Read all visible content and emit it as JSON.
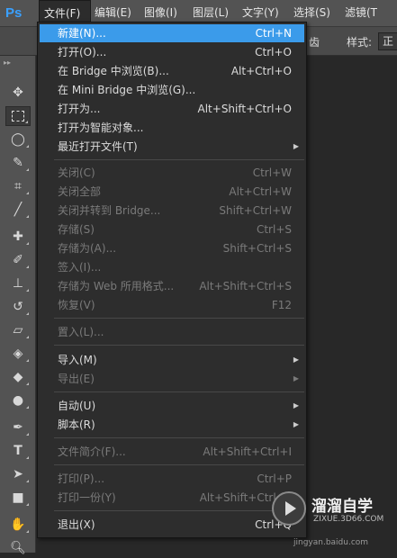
{
  "app": {
    "logo": "Ps"
  },
  "menubar": {
    "items": [
      {
        "label": "文件(F)"
      },
      {
        "label": "编辑(E)"
      },
      {
        "label": "图像(I)"
      },
      {
        "label": "图层(L)"
      },
      {
        "label": "文字(Y)"
      },
      {
        "label": "选择(S)"
      },
      {
        "label": "滤镜(T"
      }
    ]
  },
  "optionsbar": {
    "fragment": "齿",
    "style_label": "样式:",
    "style_value": "正"
  },
  "file_menu": {
    "items": [
      {
        "label": "新建(N)...",
        "shortcut": "Ctrl+N"
      },
      {
        "label": "打开(O)...",
        "shortcut": "Ctrl+O"
      },
      {
        "label": "在 Bridge 中浏览(B)...",
        "shortcut": "Alt+Ctrl+O"
      },
      {
        "label": "在 Mini Bridge 中浏览(G)...",
        "shortcut": ""
      },
      {
        "label": "打开为...",
        "shortcut": "Alt+Shift+Ctrl+O"
      },
      {
        "label": "打开为智能对象...",
        "shortcut": ""
      },
      {
        "label": "最近打开文件(T)",
        "shortcut": ""
      },
      {
        "label": "关闭(C)",
        "shortcut": "Ctrl+W"
      },
      {
        "label": "关闭全部",
        "shortcut": "Alt+Ctrl+W"
      },
      {
        "label": "关闭并转到 Bridge...",
        "shortcut": "Shift+Ctrl+W"
      },
      {
        "label": "存储(S)",
        "shortcut": "Ctrl+S"
      },
      {
        "label": "存储为(A)...",
        "shortcut": "Shift+Ctrl+S"
      },
      {
        "label": "签入(I)...",
        "shortcut": ""
      },
      {
        "label": "存储为 Web 所用格式...",
        "shortcut": "Alt+Shift+Ctrl+S"
      },
      {
        "label": "恢复(V)",
        "shortcut": "F12"
      },
      {
        "label": "置入(L)...",
        "shortcut": ""
      },
      {
        "label": "导入(M)",
        "shortcut": ""
      },
      {
        "label": "导出(E)",
        "shortcut": ""
      },
      {
        "label": "自动(U)",
        "shortcut": ""
      },
      {
        "label": "脚本(R)",
        "shortcut": ""
      },
      {
        "label": "文件简介(F)...",
        "shortcut": "Alt+Shift+Ctrl+I"
      },
      {
        "label": "打印(P)...",
        "shortcut": "Ctrl+P"
      },
      {
        "label": "打印一份(Y)",
        "shortcut": "Alt+Shift+Ctrl+P"
      },
      {
        "label": "退出(X)",
        "shortcut": "Ctrl+Q"
      }
    ]
  },
  "watermark": {
    "title": "溜溜自学",
    "subtitle": "ZIXUE.3D66.COM",
    "site": "jingyan.baidu.com"
  },
  "colors": {
    "highlight": "#3b9bea",
    "menu_bg": "#2d2d2d",
    "ps_blue": "#3aa0ff"
  },
  "tools": [
    "move-tool-icon",
    "marquee-tool-icon",
    "lasso-tool-icon",
    "quick-select-tool-icon",
    "crop-tool-icon",
    "eyedropper-tool-icon",
    "healing-brush-tool-icon",
    "brush-tool-icon",
    "clone-stamp-tool-icon",
    "history-brush-tool-icon",
    "eraser-tool-icon",
    "paint-bucket-tool-icon",
    "blur-tool-icon",
    "dodge-tool-icon",
    "pen-tool-icon",
    "type-tool-icon",
    "path-select-tool-icon",
    "rectangle-tool-icon",
    "hand-tool-icon",
    "zoom-tool-icon"
  ]
}
